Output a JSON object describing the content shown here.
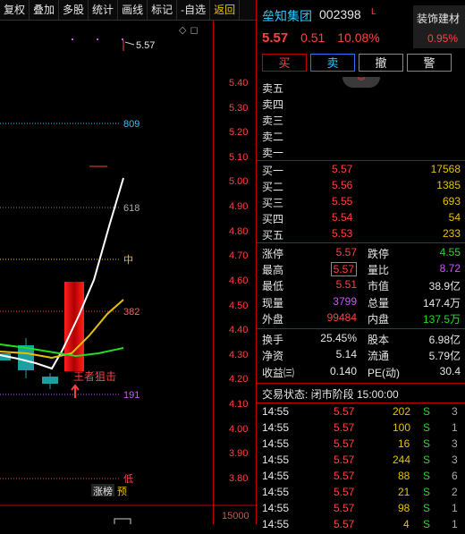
{
  "toolbar": {
    "items": [
      "复权",
      "叠加",
      "多股",
      "统计",
      "画线",
      "标记",
      "-自选",
      "返回"
    ]
  },
  "chart": {
    "price_labels": [
      "5.40",
      "5.30",
      "5.20",
      "5.10",
      "5.00",
      "4.90",
      "4.80",
      "4.70",
      "4.60",
      "4.50",
      "4.40",
      "4.30",
      "4.20",
      "4.10",
      "4.00",
      "3.90",
      "3.80"
    ],
    "high_label": "5.57",
    "low_label": "低",
    "fib": [
      "809",
      "618",
      "中",
      "382",
      "191"
    ],
    "signal": "王者狙击",
    "badge_a": "涨榜",
    "badge_b": "预",
    "volume_label": "15000"
  },
  "header": {
    "name": "垒知集团",
    "code": "002398",
    "flag": "L",
    "sector_name": "装饰建材",
    "sector_pct": "0.95%"
  },
  "quote": {
    "price": "5.57",
    "change": "0.51",
    "pct": "10.08%"
  },
  "actions": {
    "buy": "买",
    "sell": "卖",
    "cancel": "撤",
    "alert": "警"
  },
  "asks": [
    {
      "label": "卖五"
    },
    {
      "label": "卖四"
    },
    {
      "label": "卖三"
    },
    {
      "label": "卖二"
    },
    {
      "label": "卖一"
    }
  ],
  "bids": [
    {
      "label": "买一",
      "price": "5.57",
      "vol": "17568"
    },
    {
      "label": "买二",
      "price": "5.56",
      "vol": "1385"
    },
    {
      "label": "买三",
      "price": "5.55",
      "vol": "693"
    },
    {
      "label": "买四",
      "price": "5.54",
      "vol": "54"
    },
    {
      "label": "买五",
      "price": "5.53",
      "vol": "233"
    }
  ],
  "stats": {
    "zt_k": "涨停",
    "zt": "5.57",
    "dt_k": "跌停",
    "dt": "4.55",
    "high_k": "最高",
    "high": "5.57",
    "lb_k": "量比",
    "lb": "8.72",
    "low_k": "最低",
    "low": "5.51",
    "mv_k": "市值",
    "mv": "38.9亿",
    "xs_k": "现量",
    "xs": "3799",
    "zl_k": "总量",
    "zl": "147.4万",
    "wp_k": "外盘",
    "wp": "99484",
    "np_k": "内盘",
    "np": "137.5万",
    "hs_k": "换手",
    "hs": "25.45%",
    "gb_k": "股本",
    "gb": "6.98亿",
    "jz_k": "净资",
    "jz": "5.14",
    "lt_k": "流通",
    "lt": "5.79亿",
    "sy_k": "收益㈢",
    "sy": "0.140",
    "pe_k": "PE(动)",
    "pe": "30.4"
  },
  "status": "交易状态: 闭市阶段 15:00:00",
  "trades": [
    {
      "t": "14:55",
      "p": "5.57",
      "v": "202",
      "d": "S",
      "n": "3"
    },
    {
      "t": "14:55",
      "p": "5.57",
      "v": "100",
      "d": "S",
      "n": "1"
    },
    {
      "t": "14:55",
      "p": "5.57",
      "v": "16",
      "d": "S",
      "n": "3"
    },
    {
      "t": "14:55",
      "p": "5.57",
      "v": "244",
      "d": "S",
      "n": "3"
    },
    {
      "t": "14:55",
      "p": "5.57",
      "v": "88",
      "d": "S",
      "n": "6"
    },
    {
      "t": "14:55",
      "p": "5.57",
      "v": "21",
      "d": "S",
      "n": "2"
    },
    {
      "t": "14:55",
      "p": "5.57",
      "v": "98",
      "d": "S",
      "n": "1"
    },
    {
      "t": "14:55",
      "p": "5.57",
      "v": "4",
      "d": "S",
      "n": "1"
    }
  ],
  "colors": {
    "up": "#ff4040",
    "down": "#22dd22",
    "accent": "#2ec7ff",
    "gold": "#e6c200"
  }
}
